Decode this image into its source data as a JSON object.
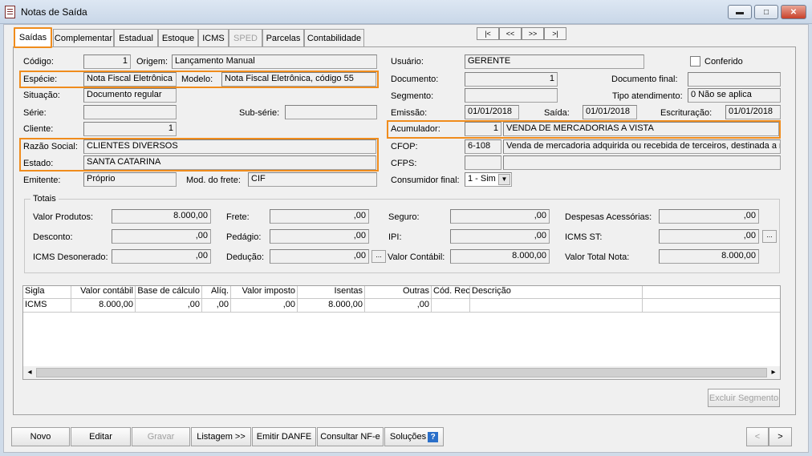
{
  "window": {
    "title": "Notas de Saída"
  },
  "tabs": [
    {
      "label": "Saídas"
    },
    {
      "label": "Complementar"
    },
    {
      "label": "Estadual"
    },
    {
      "label": "Estoque"
    },
    {
      "label": "ICMS"
    },
    {
      "label": "SPED"
    },
    {
      "label": "Parcelas"
    },
    {
      "label": "Contabilidade"
    }
  ],
  "nav": [
    "|<",
    "<<",
    ">>",
    ">|"
  ],
  "form": {
    "codigo_label": "Código:",
    "codigo": "1",
    "origem_label": "Origem:",
    "origem": "Lançamento Manual",
    "especie_label": "Espécie:",
    "especie": "Nota Fiscal Eletrônica",
    "modelo_label": "Modelo:",
    "modelo": "Nota Fiscal Eletrônica, código 55",
    "situacao_label": "Situação:",
    "situacao": "Documento regular",
    "serie_label": "Série:",
    "serie": "",
    "subserie_label": "Sub-série:",
    "subserie": "",
    "cliente_label": "Cliente:",
    "cliente": "1",
    "razao_label": "Razão Social:",
    "razao": "CLIENTES DIVERSOS",
    "estado_label": "Estado:",
    "estado": "SANTA CATARINA",
    "emitente_label": "Emitente:",
    "emitente": "Próprio",
    "frete_mod_label": "Mod. do frete:",
    "frete_mod": "CIF",
    "usuario_label": "Usuário:",
    "usuario": "GERENTE",
    "conferido_label": "Conferido",
    "documento_label": "Documento:",
    "documento": "1",
    "docfinal_label": "Documento final:",
    "docfinal": "",
    "segmento_label": "Segmento:",
    "segmento": "",
    "tipoatend_label": "Tipo atendimento:",
    "tipoatend": "0 Não se aplica",
    "emissao_label": "Emissão:",
    "emissao": "01/01/2018",
    "saida_label": "Saída:",
    "saida": "01/01/2018",
    "escrit_label": "Escrituração:",
    "escrit": "01/01/2018",
    "acum_label": "Acumulador:",
    "acum": "1",
    "acum_desc": "VENDA DE MERCADORIAS A VISTA",
    "cfop_label": "CFOP:",
    "cfop": "6-108",
    "cfop_desc": "Venda de mercadoria adquirida ou recebida de terceiros, destinada a não",
    "cfps_label": "CFPS:",
    "cfps": "",
    "cfps_desc": "",
    "consumidor_label": "Consumidor final:",
    "consumidor": "1 - Sim"
  },
  "totais": {
    "title": "Totais",
    "valor_produtos_label": "Valor Produtos:",
    "valor_produtos": "8.000,00",
    "frete_label": "Frete:",
    "frete": ",00",
    "seguro_label": "Seguro:",
    "seguro": ",00",
    "despesas_label": "Despesas Acessórias:",
    "despesas": ",00",
    "desconto_label": "Desconto:",
    "desconto": ",00",
    "pedagio_label": "Pedágio:",
    "pedagio": ",00",
    "ipi_label": "IPI:",
    "ipi": ",00",
    "icmsst_label": "ICMS ST:",
    "icmsst": ",00",
    "icmsdes_label": "ICMS Desonerado:",
    "icmsdes": ",00",
    "deducao_label": "Dedução:",
    "deducao": ",00",
    "contabil_label": "Valor Contábil:",
    "contabil": "8.000,00",
    "totalnota_label": "Valor Total Nota:",
    "totalnota": "8.000,00",
    "dots": "..."
  },
  "grid": {
    "headers": [
      "Sigla",
      "Valor contábil",
      "Base de cálculo",
      "Alíq.",
      "Valor imposto",
      "Isentas",
      "Outras",
      "Cód. Rec.",
      "Descrição"
    ],
    "rows": [
      [
        "ICMS",
        "8.000,00",
        ",00",
        ",00",
        ",00",
        "8.000,00",
        ",00",
        "",
        ""
      ]
    ]
  },
  "buttons": {
    "excluir_segmento": "Excluir Segmento",
    "novo": "Novo",
    "editar": "Editar",
    "gravar": "Gravar",
    "listagem": "Listagem >>",
    "emitir": "Emitir DANFE",
    "consultar": "Consultar NF-e",
    "solucoes": "Soluções",
    "prev": "<",
    "next": ">"
  }
}
